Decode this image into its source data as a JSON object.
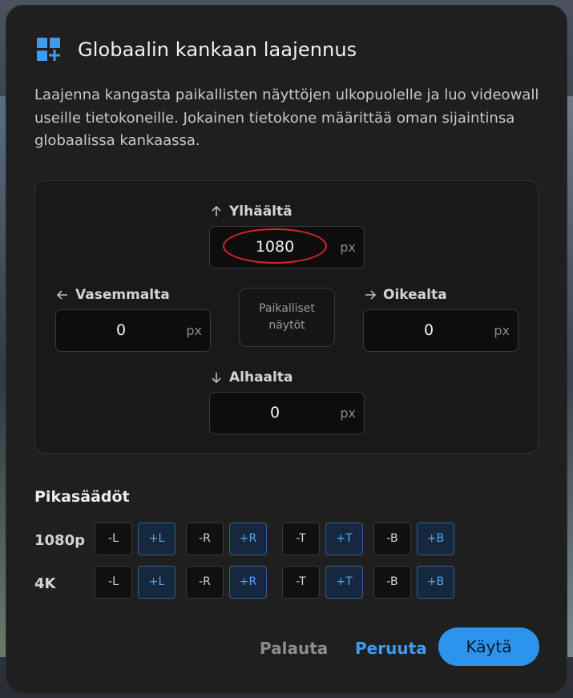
{
  "dialog": {
    "title": "Globaalin kankaan laajennus",
    "description": "Laajenna kangasta paikallisten näyttöjen ulkopuolelle ja luo videowall useille tietokoneille. Jokainen tietokone määrittää oman sijaintinsa globaalissa kankaassa.",
    "icon": "grid-add-icon"
  },
  "extents": {
    "top": {
      "label": "Ylhäältä",
      "value": "1080",
      "unit": "px"
    },
    "left": {
      "label": "Vasemmalta",
      "value": "0",
      "unit": "px"
    },
    "right": {
      "label": "Oikealta",
      "value": "0",
      "unit": "px"
    },
    "bottom": {
      "label": "Alhaalta",
      "value": "0",
      "unit": "px"
    },
    "center_label_line1": "Paikalliset",
    "center_label_line2": "näytöt"
  },
  "presets": {
    "title": "Pikasäädöt",
    "rows": [
      {
        "label": "1080p",
        "chips": [
          "-L",
          "+L",
          "-R",
          "+R",
          "-T",
          "+T",
          "-B",
          "+B"
        ]
      },
      {
        "label": "4K",
        "chips": [
          "-L",
          "+L",
          "-R",
          "+R",
          "-T",
          "+T",
          "-B",
          "+B"
        ]
      }
    ]
  },
  "actions": {
    "reset": "Palauta",
    "cancel": "Peruuta",
    "apply": "Käytä"
  },
  "colors": {
    "accent": "#2b95ee",
    "highlight": "#d8262a",
    "dialog_bg": "#1f1f1f"
  }
}
